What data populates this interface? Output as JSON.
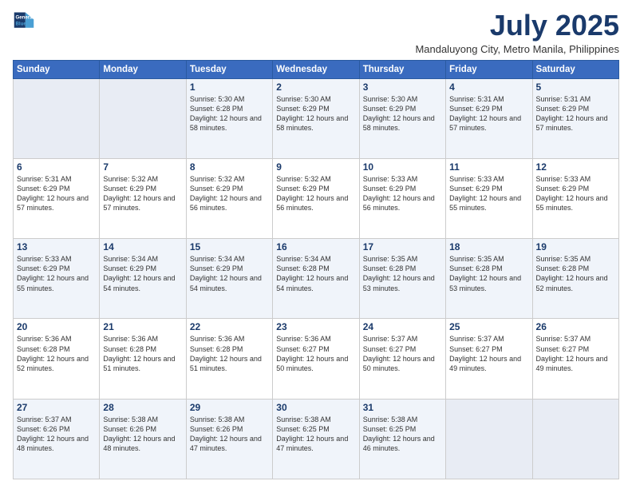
{
  "header": {
    "logo_line1": "General",
    "logo_line2": "Blue",
    "title": "July 2025",
    "location": "Mandaluyong City, Metro Manila, Philippines"
  },
  "weekdays": [
    "Sunday",
    "Monday",
    "Tuesday",
    "Wednesday",
    "Thursday",
    "Friday",
    "Saturday"
  ],
  "weeks": [
    [
      {
        "day": "",
        "info": ""
      },
      {
        "day": "",
        "info": ""
      },
      {
        "day": "1",
        "info": "Sunrise: 5:30 AM\nSunset: 6:28 PM\nDaylight: 12 hours and 58 minutes."
      },
      {
        "day": "2",
        "info": "Sunrise: 5:30 AM\nSunset: 6:29 PM\nDaylight: 12 hours and 58 minutes."
      },
      {
        "day": "3",
        "info": "Sunrise: 5:30 AM\nSunset: 6:29 PM\nDaylight: 12 hours and 58 minutes."
      },
      {
        "day": "4",
        "info": "Sunrise: 5:31 AM\nSunset: 6:29 PM\nDaylight: 12 hours and 57 minutes."
      },
      {
        "day": "5",
        "info": "Sunrise: 5:31 AM\nSunset: 6:29 PM\nDaylight: 12 hours and 57 minutes."
      }
    ],
    [
      {
        "day": "6",
        "info": "Sunrise: 5:31 AM\nSunset: 6:29 PM\nDaylight: 12 hours and 57 minutes."
      },
      {
        "day": "7",
        "info": "Sunrise: 5:32 AM\nSunset: 6:29 PM\nDaylight: 12 hours and 57 minutes."
      },
      {
        "day": "8",
        "info": "Sunrise: 5:32 AM\nSunset: 6:29 PM\nDaylight: 12 hours and 56 minutes."
      },
      {
        "day": "9",
        "info": "Sunrise: 5:32 AM\nSunset: 6:29 PM\nDaylight: 12 hours and 56 minutes."
      },
      {
        "day": "10",
        "info": "Sunrise: 5:33 AM\nSunset: 6:29 PM\nDaylight: 12 hours and 56 minutes."
      },
      {
        "day": "11",
        "info": "Sunrise: 5:33 AM\nSunset: 6:29 PM\nDaylight: 12 hours and 55 minutes."
      },
      {
        "day": "12",
        "info": "Sunrise: 5:33 AM\nSunset: 6:29 PM\nDaylight: 12 hours and 55 minutes."
      }
    ],
    [
      {
        "day": "13",
        "info": "Sunrise: 5:33 AM\nSunset: 6:29 PM\nDaylight: 12 hours and 55 minutes."
      },
      {
        "day": "14",
        "info": "Sunrise: 5:34 AM\nSunset: 6:29 PM\nDaylight: 12 hours and 54 minutes."
      },
      {
        "day": "15",
        "info": "Sunrise: 5:34 AM\nSunset: 6:29 PM\nDaylight: 12 hours and 54 minutes."
      },
      {
        "day": "16",
        "info": "Sunrise: 5:34 AM\nSunset: 6:28 PM\nDaylight: 12 hours and 54 minutes."
      },
      {
        "day": "17",
        "info": "Sunrise: 5:35 AM\nSunset: 6:28 PM\nDaylight: 12 hours and 53 minutes."
      },
      {
        "day": "18",
        "info": "Sunrise: 5:35 AM\nSunset: 6:28 PM\nDaylight: 12 hours and 53 minutes."
      },
      {
        "day": "19",
        "info": "Sunrise: 5:35 AM\nSunset: 6:28 PM\nDaylight: 12 hours and 52 minutes."
      }
    ],
    [
      {
        "day": "20",
        "info": "Sunrise: 5:36 AM\nSunset: 6:28 PM\nDaylight: 12 hours and 52 minutes."
      },
      {
        "day": "21",
        "info": "Sunrise: 5:36 AM\nSunset: 6:28 PM\nDaylight: 12 hours and 51 minutes."
      },
      {
        "day": "22",
        "info": "Sunrise: 5:36 AM\nSunset: 6:28 PM\nDaylight: 12 hours and 51 minutes."
      },
      {
        "day": "23",
        "info": "Sunrise: 5:36 AM\nSunset: 6:27 PM\nDaylight: 12 hours and 50 minutes."
      },
      {
        "day": "24",
        "info": "Sunrise: 5:37 AM\nSunset: 6:27 PM\nDaylight: 12 hours and 50 minutes."
      },
      {
        "day": "25",
        "info": "Sunrise: 5:37 AM\nSunset: 6:27 PM\nDaylight: 12 hours and 49 minutes."
      },
      {
        "day": "26",
        "info": "Sunrise: 5:37 AM\nSunset: 6:27 PM\nDaylight: 12 hours and 49 minutes."
      }
    ],
    [
      {
        "day": "27",
        "info": "Sunrise: 5:37 AM\nSunset: 6:26 PM\nDaylight: 12 hours and 48 minutes."
      },
      {
        "day": "28",
        "info": "Sunrise: 5:38 AM\nSunset: 6:26 PM\nDaylight: 12 hours and 48 minutes."
      },
      {
        "day": "29",
        "info": "Sunrise: 5:38 AM\nSunset: 6:26 PM\nDaylight: 12 hours and 47 minutes."
      },
      {
        "day": "30",
        "info": "Sunrise: 5:38 AM\nSunset: 6:25 PM\nDaylight: 12 hours and 47 minutes."
      },
      {
        "day": "31",
        "info": "Sunrise: 5:38 AM\nSunset: 6:25 PM\nDaylight: 12 hours and 46 minutes."
      },
      {
        "day": "",
        "info": ""
      },
      {
        "day": "",
        "info": ""
      }
    ]
  ]
}
